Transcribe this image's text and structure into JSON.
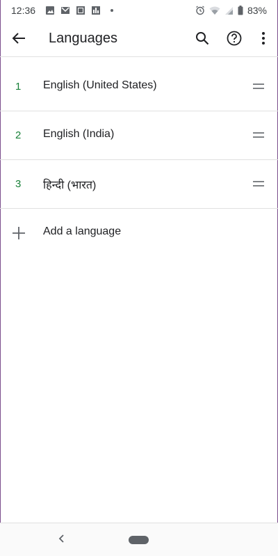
{
  "status_bar": {
    "time": "12:36",
    "battery_percent": "83%",
    "notification_icons": [
      "image-icon",
      "gmail-icon",
      "gallery-icon",
      "stats-icon"
    ],
    "system_icons": [
      "alarm-icon",
      "wifi-icon",
      "signal-icon",
      "battery-icon"
    ]
  },
  "app_bar": {
    "title": "Languages",
    "back_icon": "arrow-left-icon",
    "actions": [
      "search-icon",
      "help-icon",
      "more-vert-icon"
    ]
  },
  "languages": [
    {
      "number": "1",
      "name": "English (United States)"
    },
    {
      "number": "2",
      "name": "English (India)"
    },
    {
      "number": "3",
      "name": "हिन्दी (भारत)"
    }
  ],
  "add_language": {
    "label": "Add a language",
    "icon": "plus-icon"
  },
  "colors": {
    "accent_number": "#188038",
    "divider": "#e0e0e0",
    "text_primary": "#202124",
    "icon": "#5f6368"
  }
}
